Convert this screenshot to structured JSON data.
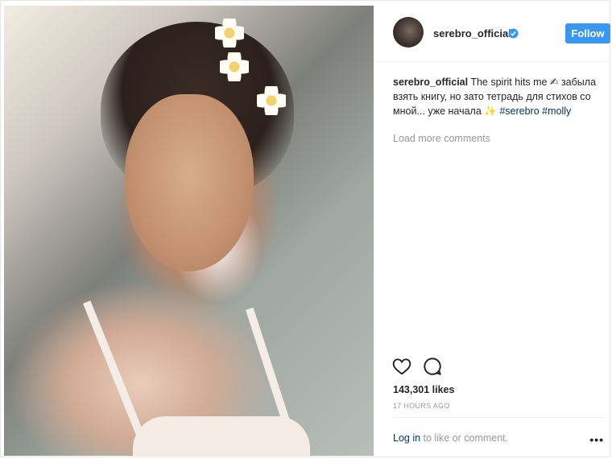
{
  "post": {
    "username": "serebro_official",
    "verified_icon": "verified-badge-icon",
    "follow_label": "Follow",
    "caption": {
      "username": "serebro_official",
      "text_1": "The spirit hits me ✍",
      "text_2": "забыла взять книгу, но зато тетрадь для стихов со мной... уже начала ✨",
      "hashtag_1": "#serebro",
      "hashtag_2": "#molly"
    },
    "load_more": "Load more comments",
    "likes": "143,301 likes",
    "timestamp": "17 HOURS AGO",
    "login_link": "Log in",
    "login_rest": " to like or comment.",
    "more": "•••"
  },
  "colors": {
    "follow_button": "#3897f0",
    "hashtag": "#003569",
    "secondary_text": "#999999"
  }
}
